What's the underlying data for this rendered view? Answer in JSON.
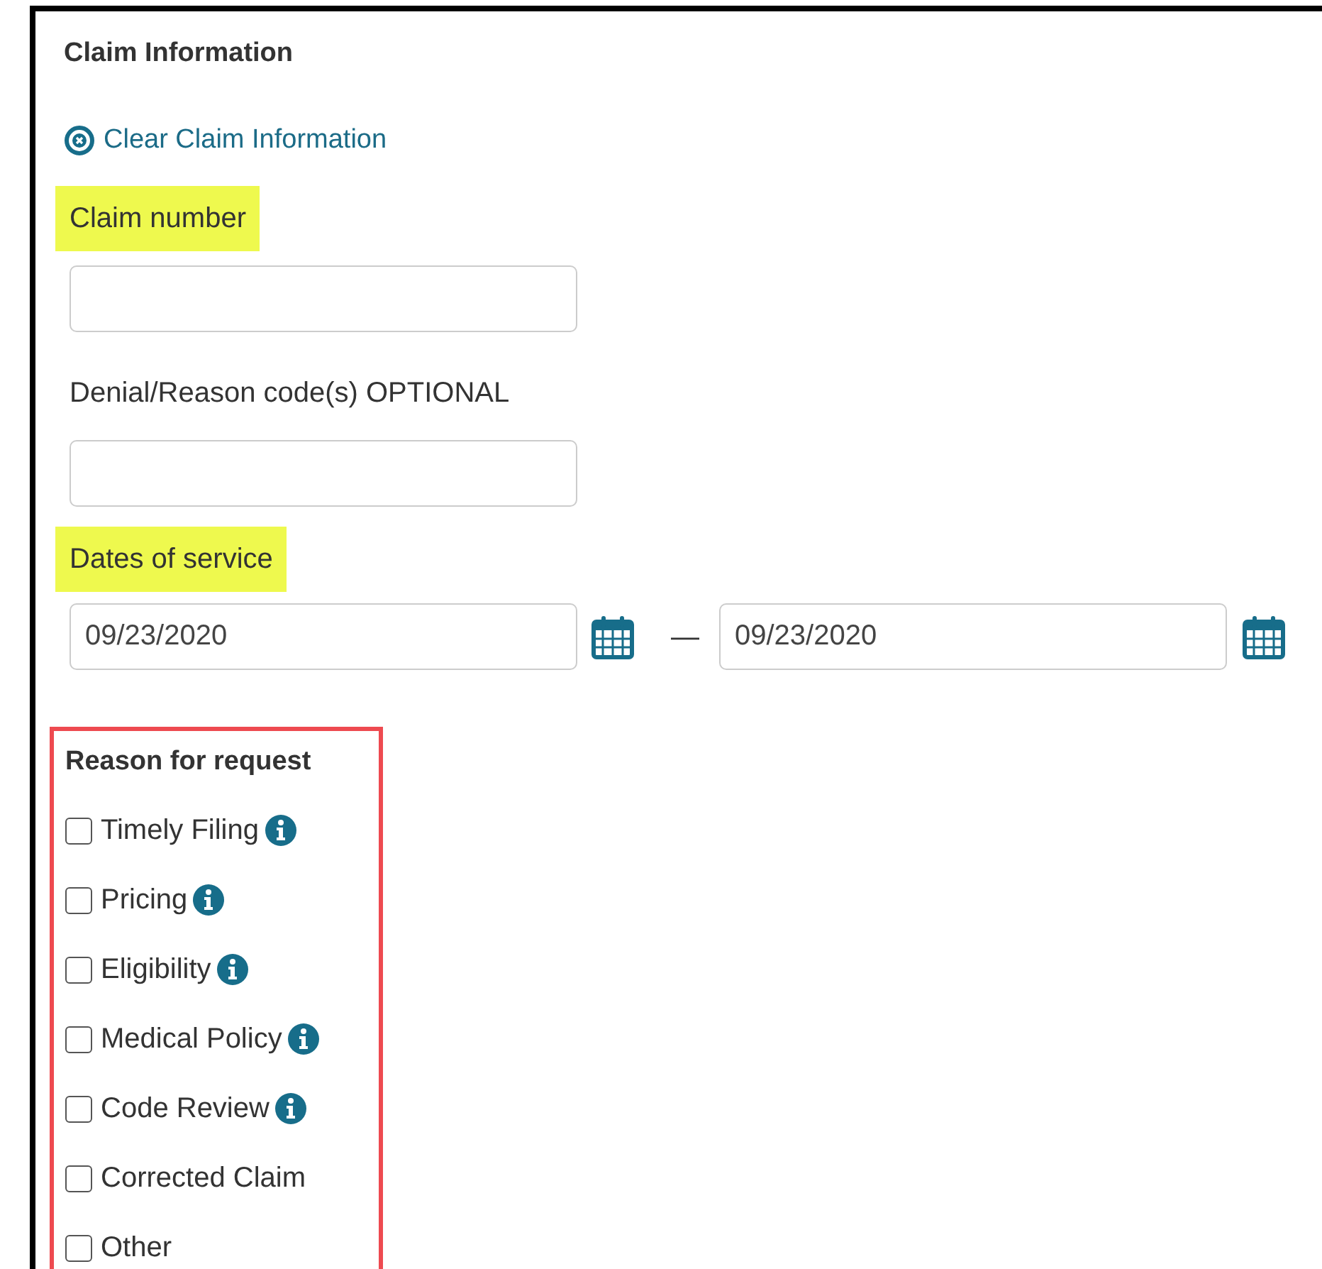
{
  "section_title": "Claim Information",
  "clear_link": "Clear Claim Information",
  "fields": [
    {
      "label": "Claim number",
      "highlighted": true
    },
    {
      "label": "Denial/Reason code(s) OPTIONAL",
      "highlighted": false
    }
  ],
  "dates": {
    "label": "Dates of service",
    "highlighted": true,
    "from": "09/23/2020",
    "separator": "—",
    "to": "09/23/2020"
  },
  "reasons": {
    "title": "Reason for request",
    "outlined": true,
    "items": [
      {
        "label": "Timely Filing",
        "checked": false,
        "info": true
      },
      {
        "label": "Pricing",
        "checked": false,
        "info": true
      },
      {
        "label": "Eligibility",
        "checked": false,
        "info": true
      },
      {
        "label": "Medical Policy",
        "checked": false,
        "info": true
      },
      {
        "label": "Code Review",
        "checked": false,
        "info": true
      },
      {
        "label": "Corrected Claim",
        "checked": false,
        "info": false
      },
      {
        "label": "Other",
        "checked": false,
        "info": false
      }
    ]
  }
}
